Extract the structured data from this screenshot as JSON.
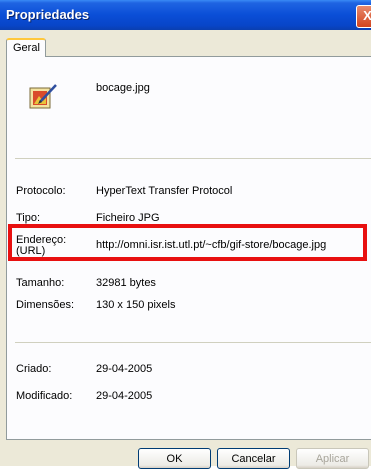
{
  "window": {
    "title": "Propriedades",
    "close_glyph": "X"
  },
  "tabs": [
    {
      "label": "Geral"
    }
  ],
  "file": {
    "name": "bocage.jpg",
    "icon": "jpg-image-file-icon"
  },
  "properties": {
    "protocol": {
      "label": "Protocolo:",
      "value": "HyperText Transfer Protocol"
    },
    "type": {
      "label": "Tipo:",
      "value": "Ficheiro JPG"
    },
    "address": {
      "label_line1": "Endereço:",
      "label_line2": "(URL)",
      "value": "http://omni.isr.ist.utl.pt/~cfb/gif-store/bocage.jpg"
    },
    "size": {
      "label": "Tamanho:",
      "value": "32981 bytes"
    },
    "dimensions": {
      "label": "Dimensões:",
      "value": "130 x 150 pixels"
    },
    "created": {
      "label": "Criado:",
      "value": "29-04-2005"
    },
    "modified": {
      "label": "Modificado:",
      "value": "29-04-2005"
    }
  },
  "buttons": {
    "ok": "OK",
    "cancel": "Cancelar",
    "apply": "Aplicar"
  },
  "colors": {
    "highlight": "#e81010",
    "titlebar": "#0a4ed7"
  }
}
